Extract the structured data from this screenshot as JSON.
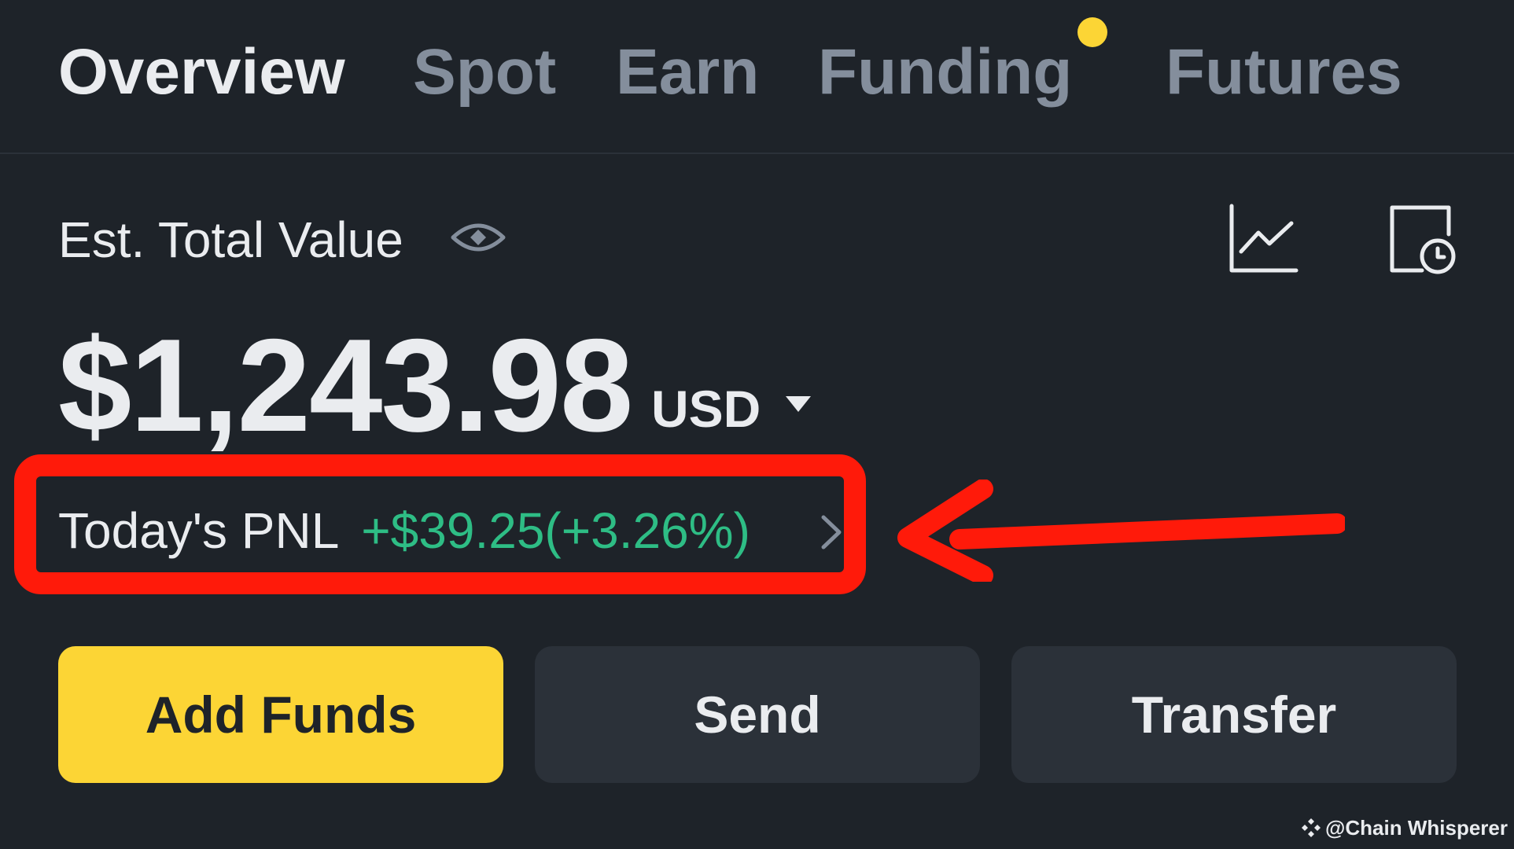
{
  "tabs": {
    "overview": "Overview",
    "spot": "Spot",
    "earn": "Earn",
    "funding": "Funding",
    "futures": "Futures",
    "active": "overview",
    "funding_has_notification": true
  },
  "summary": {
    "label": "Est. Total Value",
    "balance": "$1,243.98",
    "currency": "USD"
  },
  "pnl": {
    "label": "Today's PNL",
    "value": "+$39.25(+3.26%)"
  },
  "actions": {
    "add_funds": "Add Funds",
    "send": "Send",
    "transfer": "Transfer"
  },
  "watermark": {
    "text": "@Chain Whisperer"
  },
  "icons": {
    "visibility": "eye-icon",
    "analytics": "line-chart-icon",
    "history": "history-icon",
    "currency_selector": "caret-down-icon",
    "pnl_detail": "chevron-right-icon"
  },
  "colors": {
    "background": "#1e2329",
    "accent": "#fcd535",
    "positive": "#2ebd85",
    "annotation": "#ff1a0a",
    "muted_text": "#848e9c",
    "secondary_button": "#2b3139"
  }
}
